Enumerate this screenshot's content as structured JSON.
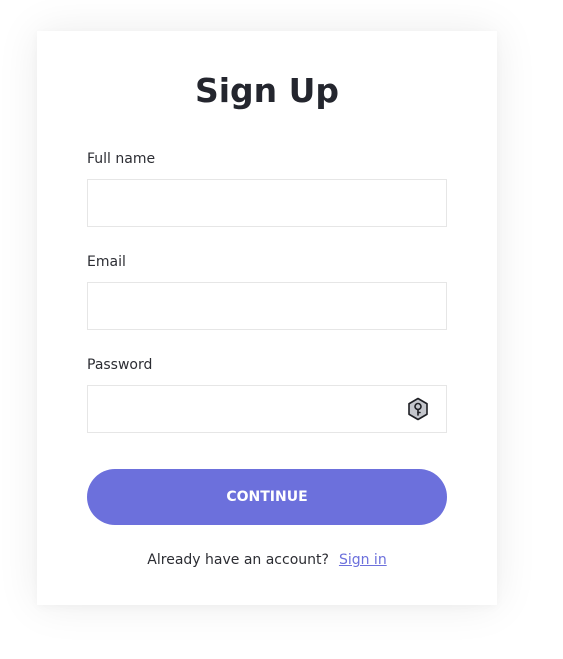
{
  "form": {
    "title": "Sign Up",
    "full_name": {
      "label": "Full name",
      "value": "",
      "placeholder": ""
    },
    "email": {
      "label": "Email",
      "value": "",
      "placeholder": ""
    },
    "password": {
      "label": "Password",
      "value": "",
      "placeholder": "",
      "icon": "key-icon"
    },
    "continue_label": "CONTINUE",
    "footer_text": "Already have an account?",
    "signin_label": "Sign in"
  },
  "colors": {
    "accent": "#6c70dc",
    "text": "#24262e",
    "border": "#e6e6e6"
  }
}
